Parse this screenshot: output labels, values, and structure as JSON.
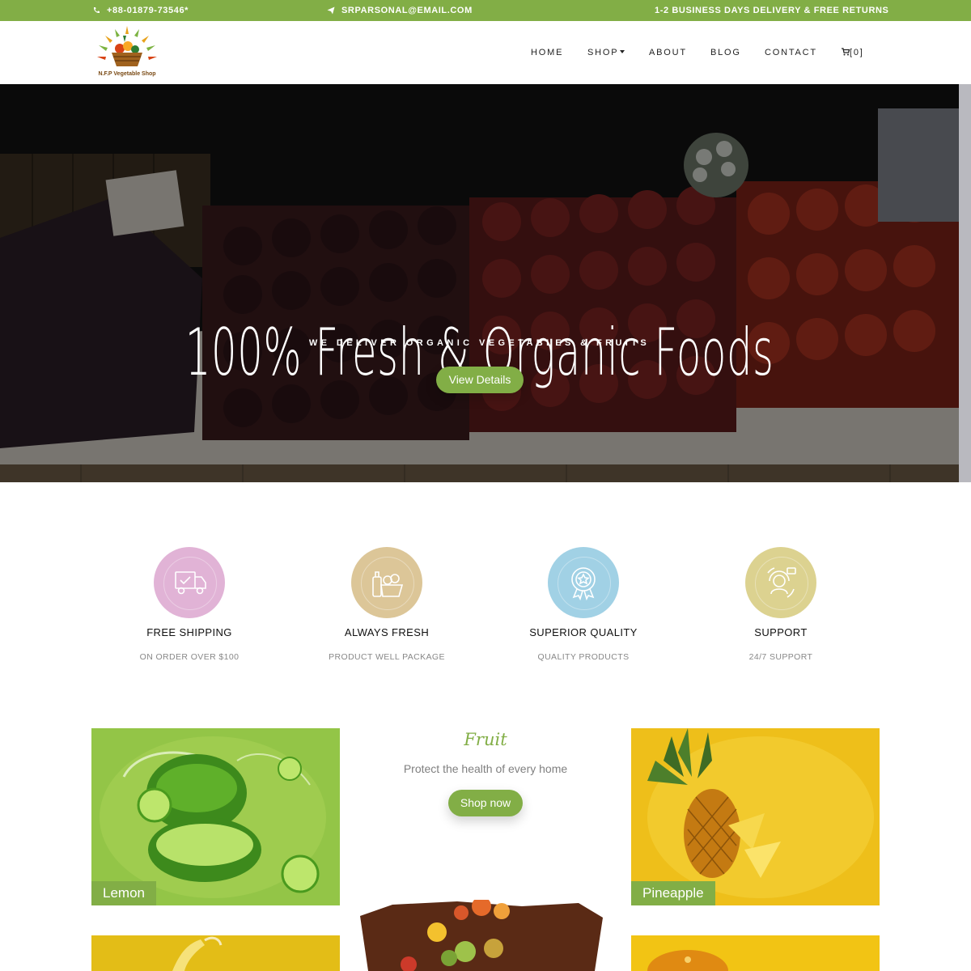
{
  "topbar": {
    "phone": "+88-01879-73546*",
    "email": "SRPARSONAL@EMAIL.COM",
    "delivery": "1-2 BUSINESS DAYS DELIVERY & FREE RETURNS",
    "icons": {
      "phone": "phone-icon",
      "email": "paper-plane-icon"
    }
  },
  "header": {
    "logo_text": "N.F.P Vegetable Shop",
    "nav": [
      {
        "label": "HOME"
      },
      {
        "label": "SHOP"
      },
      {
        "label": "ABOUT"
      },
      {
        "label": "BLOG"
      },
      {
        "label": "CONTACT"
      },
      {
        "label": "[0]",
        "icon": "cart-icon"
      }
    ]
  },
  "hero": {
    "title": "100% Fresh & Organic Foods",
    "subtitle": "WE DELIVER ORGANIC VEGETABLES & FRUITS",
    "button": "View Details"
  },
  "features": [
    {
      "title": "FREE SHIPPING",
      "desc": "ON ORDER OVER $100",
      "icon": "delivery-truck-icon",
      "color": "#e1b3d6"
    },
    {
      "title": "ALWAYS FRESH",
      "desc": "PRODUCT WELL PACKAGE",
      "icon": "fresh-basket-icon",
      "color": "#dcc698"
    },
    {
      "title": "SUPERIOR QUALITY",
      "desc": "QUALITY PRODUCTS",
      "icon": "quality-badge-icon",
      "color": "#a1d1e5"
    },
    {
      "title": "SUPPORT",
      "desc": "24/7 SUPPORT",
      "icon": "support-agent-icon",
      "color": "#dcd290"
    }
  ],
  "categories": {
    "heading": "Fruit",
    "subtitle": "Protect the health of every home",
    "button": "Shop now",
    "tiles": [
      {
        "label": "Lemon"
      },
      {
        "label": "Pineapple"
      }
    ]
  },
  "colors": {
    "accent": "#82ae46",
    "text": "#222222",
    "muted": "#808080"
  }
}
